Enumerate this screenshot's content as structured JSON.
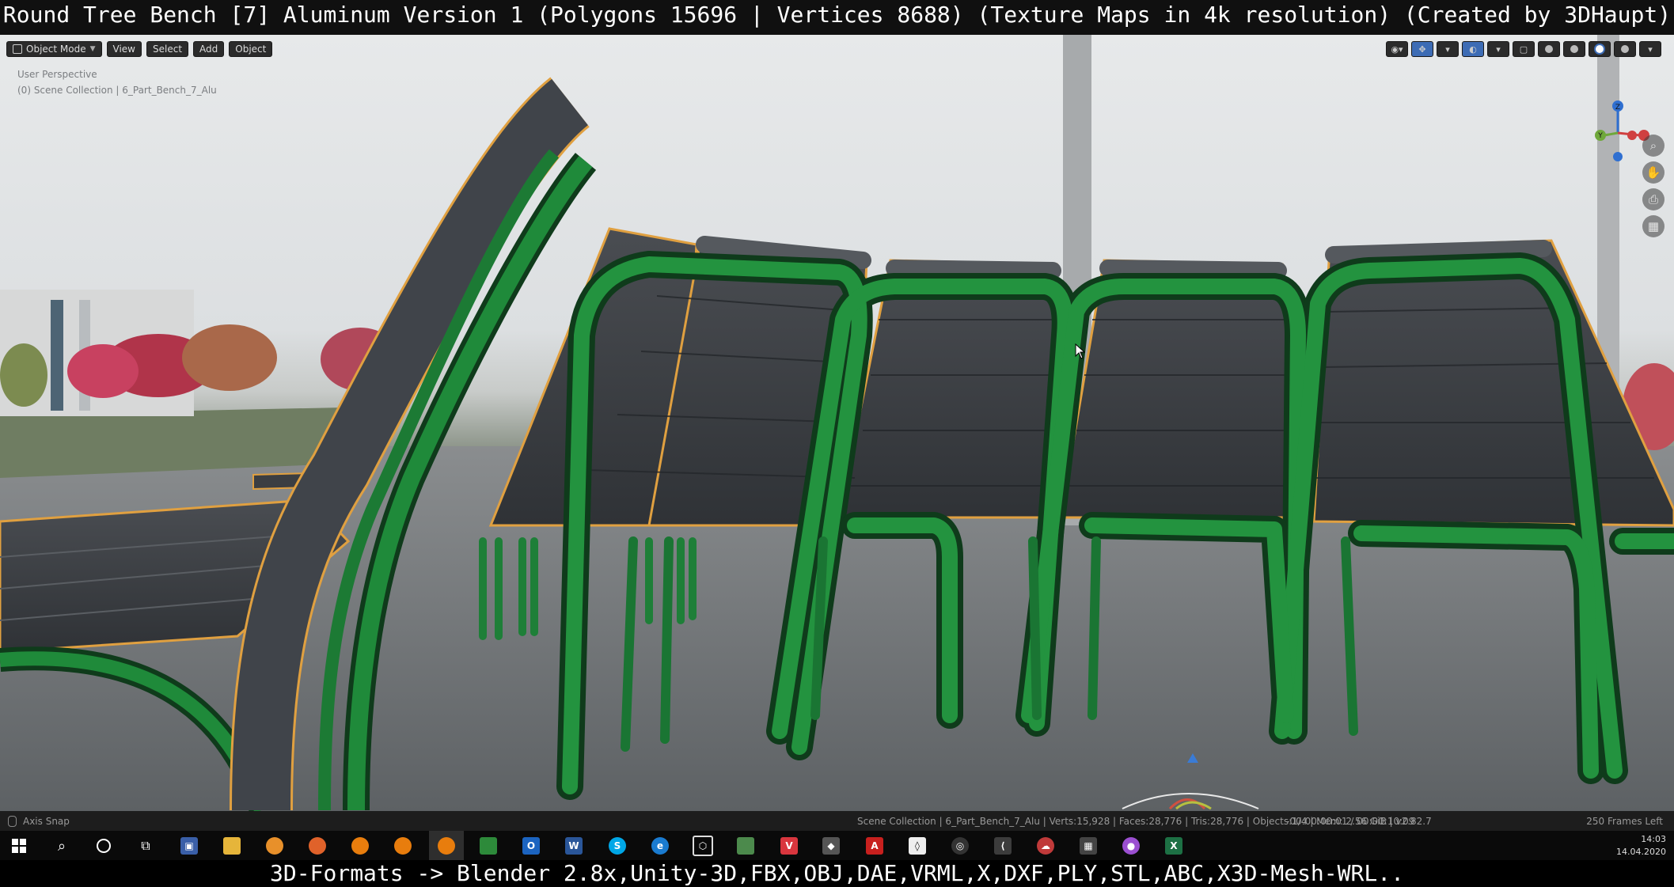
{
  "top_caption": "Round Tree Bench [7] Aluminum Version 1 (Polygons 15696 | Vertices 8688) (Texture Maps in 4k resolution) (Created by 3DHaupt)",
  "viewport": {
    "header": {
      "mode": "Object Mode",
      "menus": [
        "View",
        "Select",
        "Add",
        "Object"
      ]
    },
    "info_line1": "User Perspective",
    "info_line2": "(0) Scene Collection | 6_Part_Bench_7_Alu",
    "gizmo": {
      "z_label": "Z",
      "y_label": "Y"
    },
    "nav_tools": [
      "zoom-icon",
      "pan-hand-icon",
      "camera-icon",
      "grid-icon"
    ]
  },
  "status_bar": {
    "left_label": "Axis Snap",
    "stats": "Scene Collection | 6_Part_Bench_7_Alu | Verts:15,928 | Faces:28,776 | Tris:28,776 | Objects:1/4 | Mem: 2.56 GiB | v2.82.7",
    "time": "-00:00:00:01 / 00:00:10:09",
    "frames": "250 Frames Left"
  },
  "taskbar": {
    "clock_time": "14:03",
    "clock_date": "14.04.2020",
    "apps": [
      "start",
      "search",
      "cortana",
      "task-view",
      "save",
      "explorer",
      "fire-app",
      "firefox",
      "blender",
      "blender",
      "blender",
      "image-app",
      "outlook",
      "word",
      "skype",
      "edge",
      "cube-app",
      "green-app",
      "vivaldi",
      "app",
      "acrobat",
      "unity",
      "steam-app",
      "vscode",
      "cloud-app",
      "calculator",
      "maps",
      "excel"
    ]
  },
  "bottom_caption": "3D-Formats -> Blender 2.8x,Unity-3D,FBX,OBJ,DAE,VRML,X,DXF,PLY,STL,ABC,X3D-Mesh-WRL.."
}
